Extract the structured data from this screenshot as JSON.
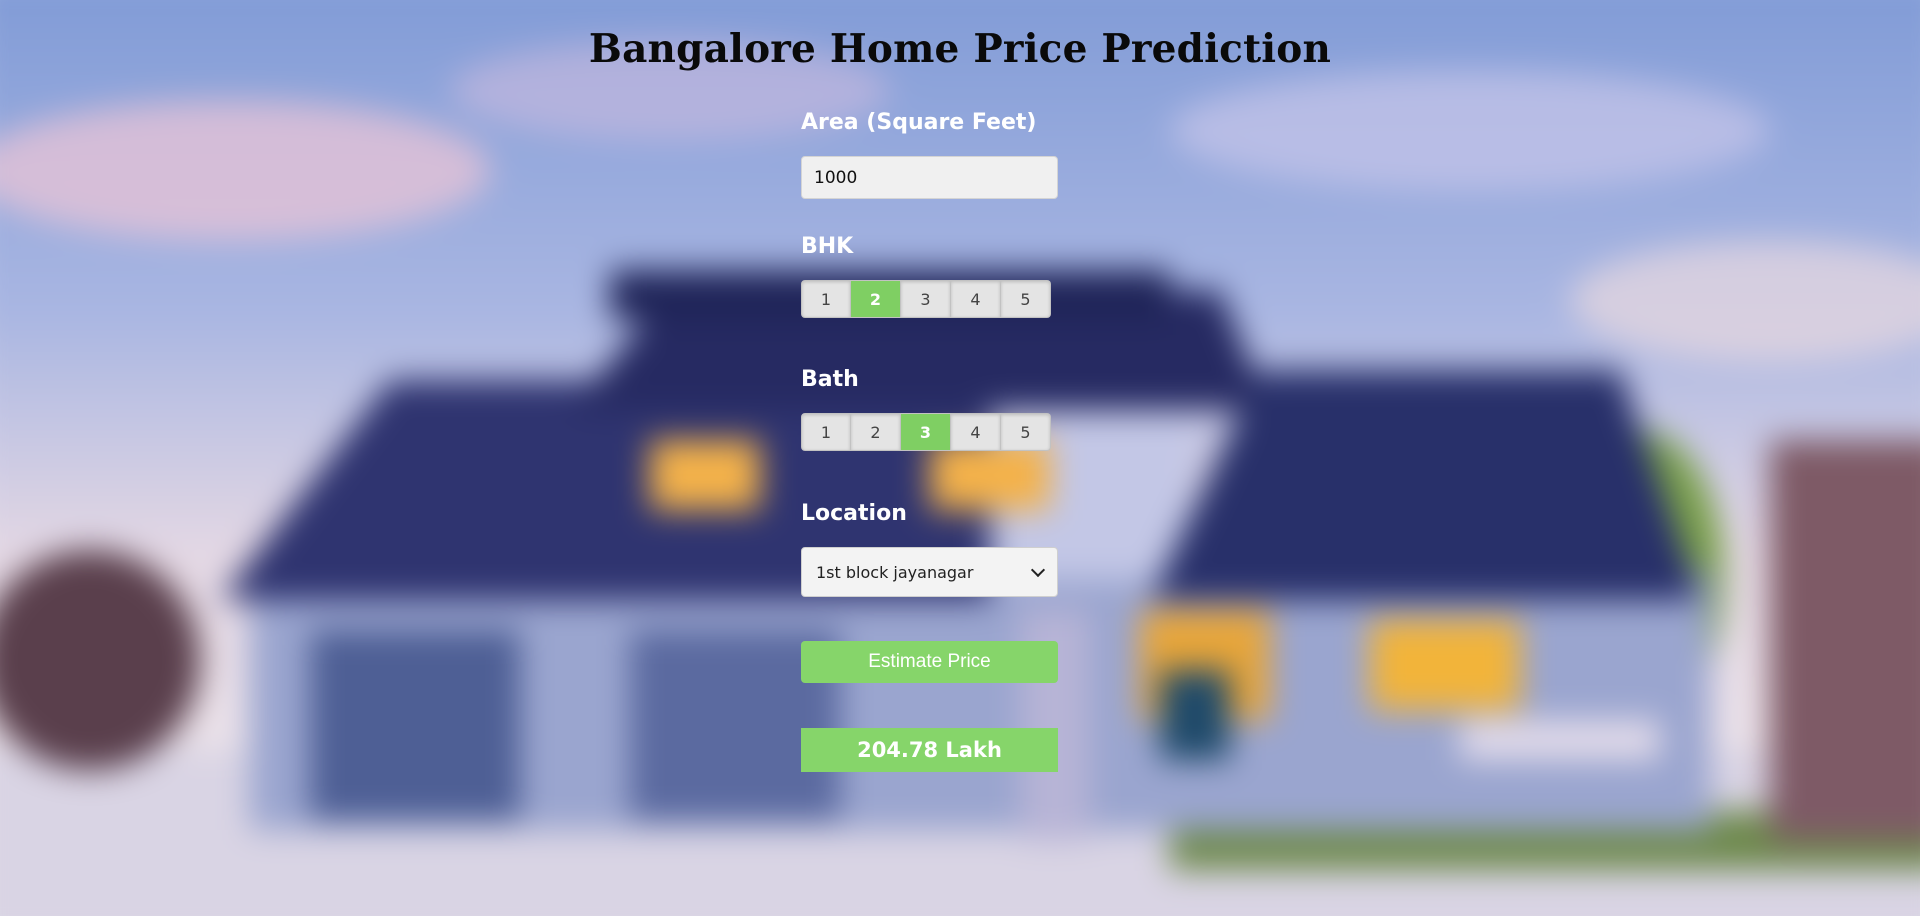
{
  "title": "Bangalore Home Price Prediction",
  "area": {
    "label": "Area (Square Feet)",
    "value": "1000"
  },
  "bhk": {
    "label": "BHK",
    "options": [
      "1",
      "2",
      "3",
      "4",
      "5"
    ],
    "selected": "2"
  },
  "bath": {
    "label": "Bath",
    "options": [
      "1",
      "2",
      "3",
      "4",
      "5"
    ],
    "selected": "3"
  },
  "location": {
    "label": "Location",
    "selected": "1st block jayanagar"
  },
  "estimate_button": "Estimate Price",
  "result": "204.78 Lakh",
  "colors": {
    "accent_green": "#86d56a",
    "title_text": "#0a0a0a",
    "label_text": "#ffffff"
  }
}
